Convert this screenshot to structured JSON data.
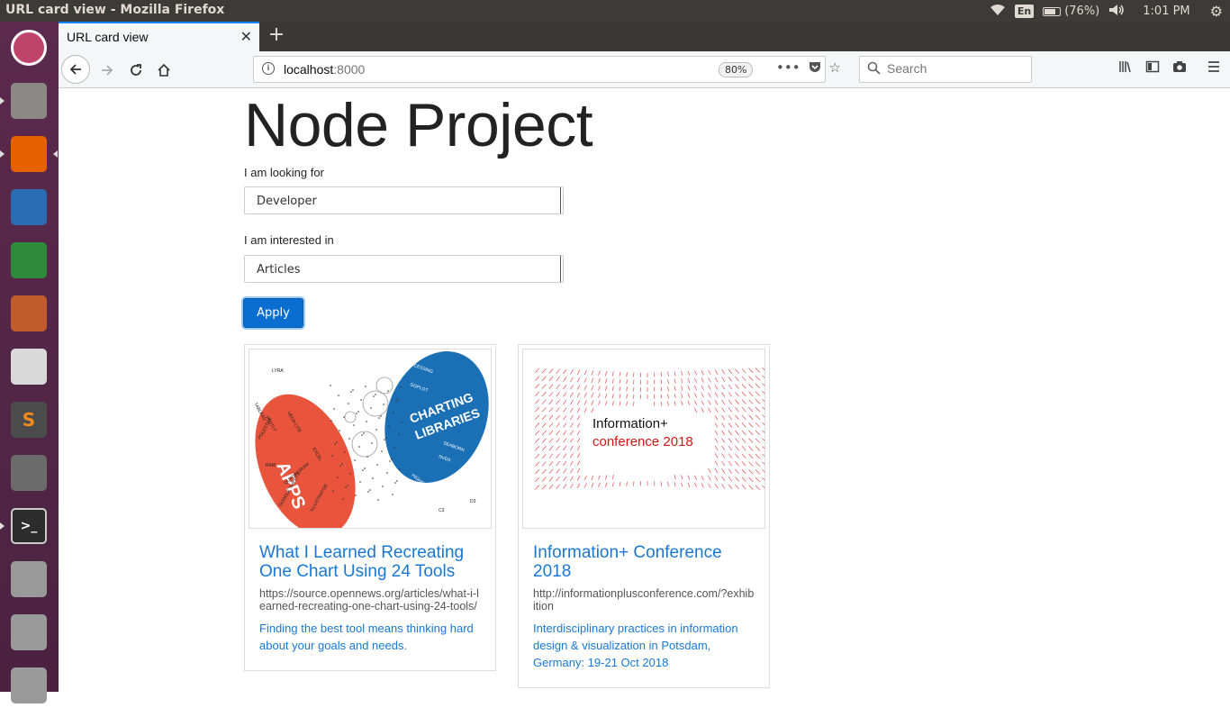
{
  "os": {
    "window_title": "URL card view - Mozilla Firefox",
    "keyboard_layout": "En",
    "battery": "(76%)",
    "battery_level": 0.76,
    "clock": "1:01 PM"
  },
  "launcher": {
    "items": [
      {
        "name": "ubuntu-dash-icon",
        "color": "#c0436b"
      },
      {
        "name": "files-icon",
        "color": "#8a8986"
      },
      {
        "name": "firefox-icon",
        "color": "#e66000"
      },
      {
        "name": "writer-icon",
        "color": "#2a6db5"
      },
      {
        "name": "calc-icon",
        "color": "#2e8b3a"
      },
      {
        "name": "impress-icon",
        "color": "#c15b2b"
      },
      {
        "name": "document-viewer-icon",
        "color": "#d9d9d9"
      },
      {
        "name": "sublime-text-icon",
        "color": "#4b4b4b"
      },
      {
        "name": "system-settings-icon",
        "color": "#6b6b6b"
      },
      {
        "name": "terminal-icon",
        "color": "#2c2c2c"
      },
      {
        "name": "drive-icon",
        "color": "#9a9a9a"
      },
      {
        "name": "drive-icon-2",
        "color": "#9a9a9a"
      },
      {
        "name": "trash-icon",
        "color": "#9a9a9a"
      }
    ]
  },
  "browser": {
    "tab_title": "URL card view",
    "url_host": "localhost",
    "url_port": ":8000",
    "zoom": "80%",
    "search_placeholder": "Search",
    "accent": "#0a84ff"
  },
  "page": {
    "title": "Node Project",
    "looking_for_label": "I am looking for",
    "looking_for_value": "Developer",
    "interested_in_label": "I am interested in",
    "interested_in_value": "Articles",
    "apply_label": "Apply",
    "cards": [
      {
        "title": "What I Learned Recreating One Chart Using 24 Tools",
        "url": "https://source.opennews.org/articles/what-i-learned-recreating-one-chart-using-24-tools/",
        "description": "Finding the best tool means thinking hard about your goals and needs.",
        "image": {
          "left_label": "APPS",
          "right_label_1": "CHARTING",
          "right_label_2": "LIBRARIES",
          "small_labels_left": [
            "LYRA",
            "PLOTLY",
            "POLESTAR",
            "VEGA-LITE",
            "RAW",
            "QUADRIGRAM",
            "GOOGLE SHEETS",
            "ILLUSTRATOR",
            "EXCEL",
            "TABLEAU"
          ],
          "small_labels_right": [
            "PROCESSING",
            "GGPLOT",
            "SEABORN",
            "NVD3",
            "HIGHCHARTS",
            "HIGHCHARTS CLOUD",
            "D3",
            "C3"
          ]
        }
      },
      {
        "title": "Information+ Conference 2018",
        "url": "http://informationplusconference.com/?exhibition",
        "description": "Interdisciplinary practices in information design & visualization in Potsdam, Germany: 19-21 Oct 2018",
        "image": {
          "line1": "Information+",
          "line2": "conference 2018"
        }
      }
    ]
  }
}
